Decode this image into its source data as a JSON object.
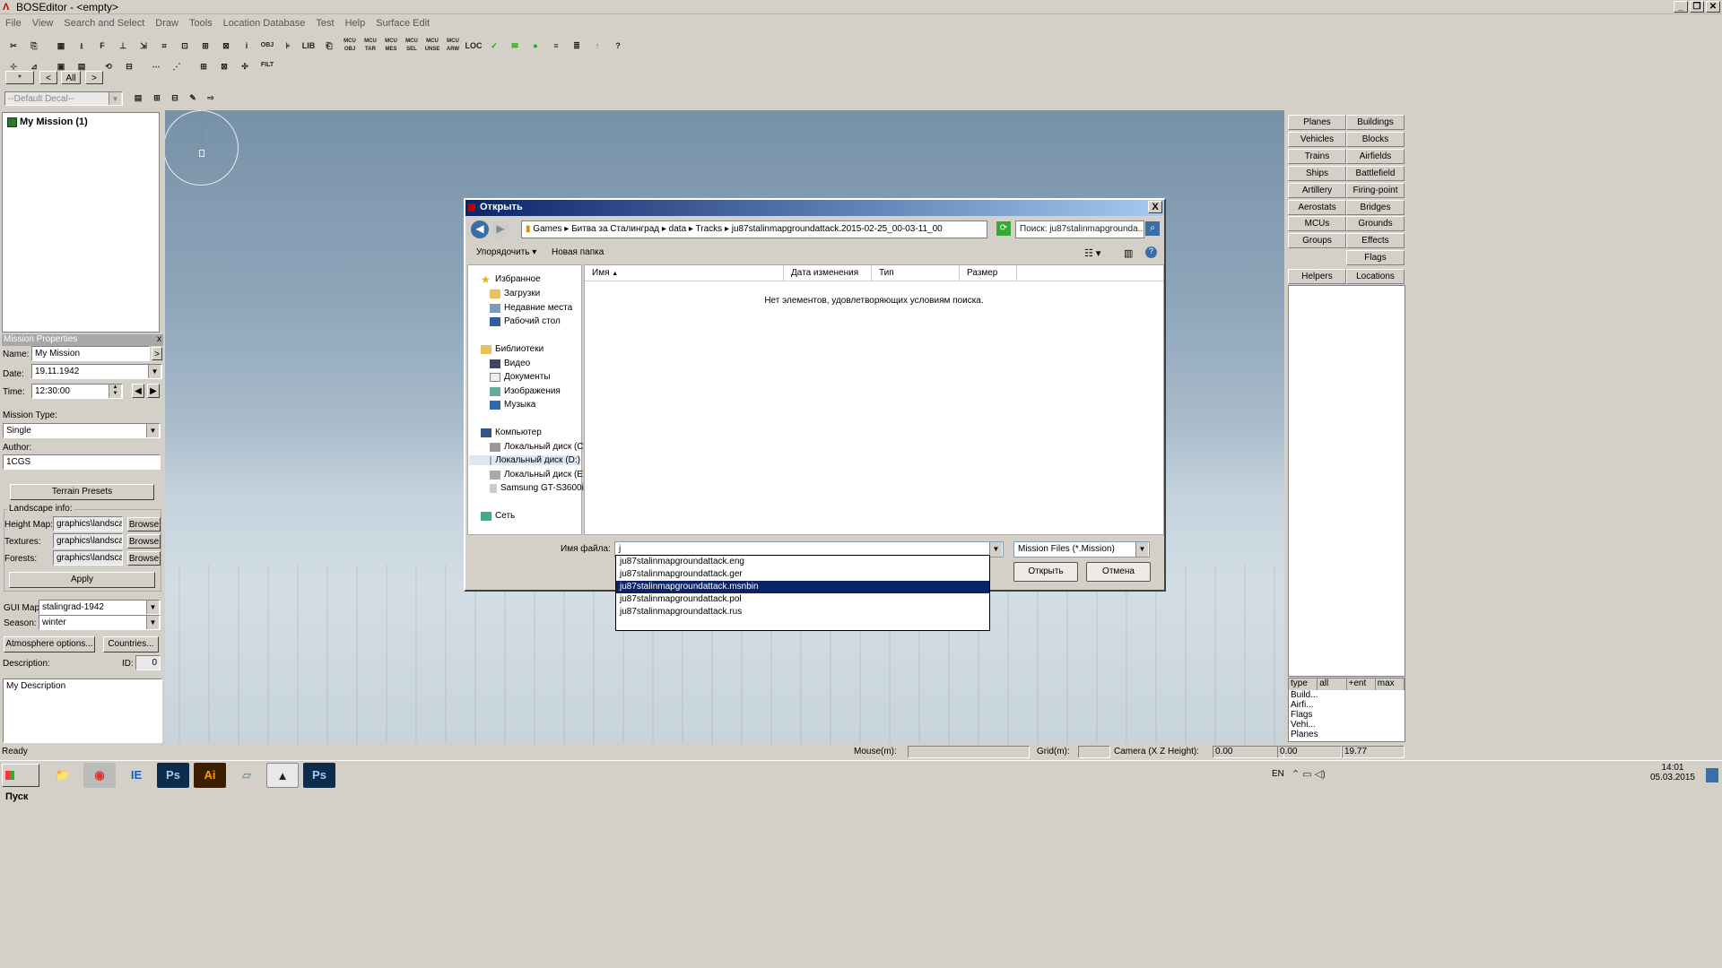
{
  "app": {
    "title": "BOSEditor - <empty>"
  },
  "menu": [
    "File",
    "View",
    "Search and Select",
    "Draw",
    "Tools",
    "Location Database",
    "Test",
    "Help",
    "Surface Edit"
  ],
  "toolbar1": [
    "✂",
    "⎘",
    "▦",
    "⭳",
    "F",
    "⊥",
    "⇲",
    "⌗",
    "⊡",
    "⊞",
    "⊠",
    "i",
    "OBJ FILT",
    "⊧",
    "LIB",
    "⎗",
    "MCU OBJ",
    "MCU TAR",
    "MCU MES",
    "MCU SEL",
    "MCU UNSE",
    "MCU ARW",
    "LOC",
    "✓",
    "✉",
    "●",
    "≡",
    "≣",
    "↑",
    "?"
  ],
  "toolbar2": [
    "⊹",
    "⊿",
    "▣",
    "▤",
    "⟲",
    "⊟",
    "⋯",
    "⋰",
    "⊞",
    "⊠",
    "✣"
  ],
  "nav_buttons": [
    "*",
    "<",
    "All",
    ">"
  ],
  "decal": {
    "value": "--Default Decal--"
  },
  "tree": {
    "root": "My Mission (1)"
  },
  "mission_properties": {
    "title": "Mission Properties",
    "close": "x",
    "name_label": "Name:",
    "name": "My Mission",
    "name_btn": ">",
    "date_label": "Date:",
    "date": "19.11.1942",
    "time_label": "Time:",
    "time": "12:30:00",
    "mission_type_label": "Mission Type:",
    "mission_type": "Single",
    "author_label": "Author:",
    "author": "1CGS",
    "terrain_presets": "Terrain Presets",
    "landscape_label": "Landscape info:",
    "height_map_label": "Height Map:",
    "height_map": "graphics\\landscape",
    "textures_label": "Textures:",
    "textures": "graphics\\landscape",
    "forests_label": "Forests:",
    "forests": "graphics\\landscape",
    "browse": "Browse",
    "apply": "Apply",
    "gui_map_label": "GUI Map:",
    "gui_map": "stalingrad-1942",
    "season_label": "Season:",
    "season": "winter",
    "atmosphere": "Atmosphere options...",
    "countries": "Countries...",
    "description_label": "Description:",
    "id_label": "ID:",
    "id": "0",
    "description": "My Description"
  },
  "right_panel": {
    "buttons": [
      [
        "Planes",
        "Buildings"
      ],
      [
        "Vehicles",
        "Blocks"
      ],
      [
        "Trains",
        "Airfields"
      ],
      [
        "Ships",
        "Battlefield"
      ],
      [
        "Artillery",
        "Firing-point"
      ],
      [
        "Aerostats",
        "Bridges"
      ],
      [
        "MCUs",
        "Grounds"
      ],
      [
        "Groups",
        "Effects"
      ],
      [
        "",
        "Flags"
      ],
      [
        "Helpers",
        "Locations"
      ]
    ]
  },
  "stats": {
    "headers": [
      "type",
      "all",
      "+ent",
      "max"
    ],
    "rows": [
      "Build...",
      "Airfi...",
      "Flags",
      "Vehi...",
      "Planes"
    ]
  },
  "status": {
    "ready": "Ready",
    "mouse_label": "Mouse(m):",
    "grid_label": "Grid(m):",
    "camera_label": "Camera (X Z Height):",
    "camera_x": "0.00",
    "camera_z": "0.00",
    "camera_h": "19.77"
  },
  "taskbar": {
    "start": "Пуск",
    "apps": [
      "📁",
      "◉",
      "IE",
      "Ps",
      "Ai",
      "▱",
      "▲",
      "Ps"
    ],
    "lang": "EN",
    "time": "14:01",
    "date": "05.03.2015"
  },
  "dialog": {
    "title": "Открыть",
    "close": "X",
    "path": "Games ▸ Битва за Сталинград ▸ data ▸ Tracks ▸ ju87stalinmapgroundattack.2015-02-25_00-03-11_00",
    "search_placeholder": "Поиск: ju87stalinmapgrounda...",
    "organize": "Упорядочить ▾",
    "new_folder": "Новая папка",
    "nav": {
      "favorites": "Избранное",
      "downloads": "Загрузки",
      "recent": "Недавние места",
      "desktop": "Рабочий стол",
      "libraries": "Библиотеки",
      "video": "Видео",
      "documents": "Документы",
      "images": "Изображения",
      "music": "Музыка",
      "computer": "Компьютер",
      "disk_c": "Локальный диск (C:)",
      "disk_d": "Локальный диск (D:)",
      "disk_e": "Локальный диск (E:)",
      "samsung": "Samsung GT-S3600i",
      "network": "Сеть"
    },
    "columns": [
      "Имя",
      "Дата изменения",
      "Тип",
      "Размер"
    ],
    "empty_text": "Нет элементов, удовлетворяющих условиям поиска.",
    "filename_label": "Имя файла:",
    "filename_value": "j",
    "filetype": "Mission Files (*.Mission)",
    "open": "Открыть",
    "cancel": "Отмена",
    "suggestions": [
      "ju87stalinmapgroundattack.eng",
      "ju87stalinmapgroundattack.ger",
      "ju87stalinmapgroundattack.msnbin",
      "ju87stalinmapgroundattack.pol",
      "ju87stalinmapgroundattack.rus"
    ],
    "selected_suggestion": 2
  }
}
